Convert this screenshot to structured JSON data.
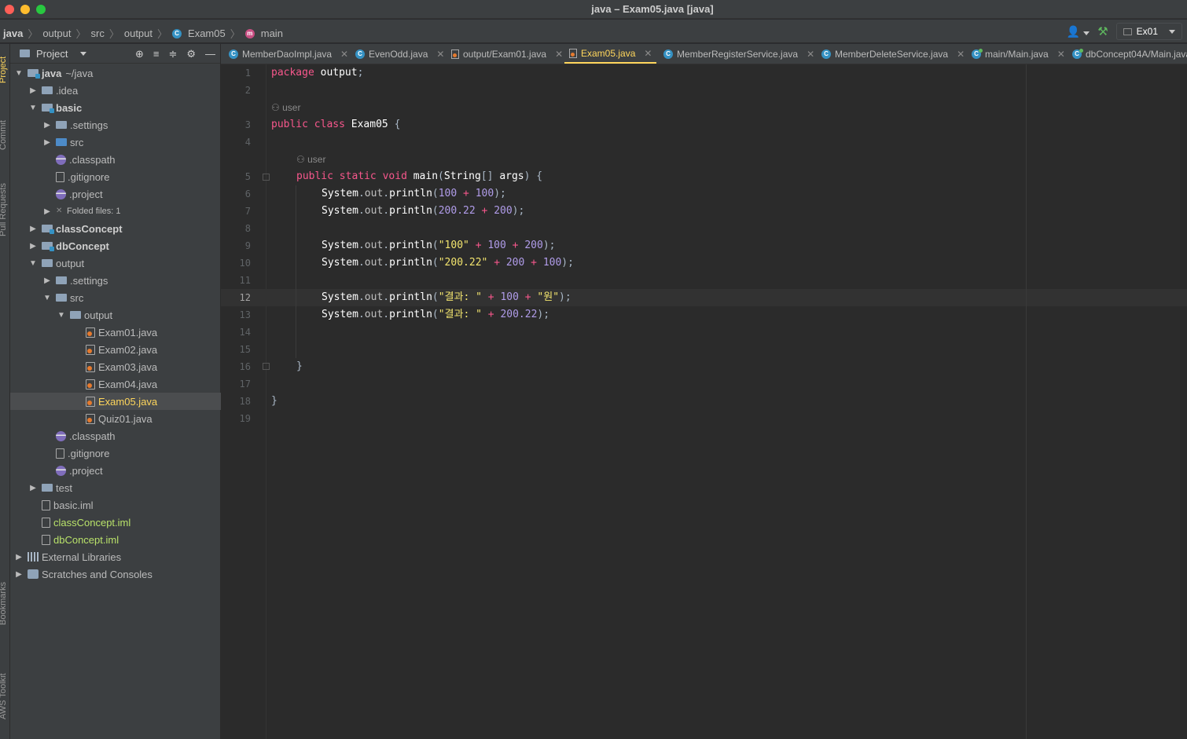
{
  "window": {
    "title": "java – Exam05.java [java]"
  },
  "breadcrumb": {
    "items": [
      "java",
      "output",
      "src",
      "output",
      "Exam05",
      "main"
    ]
  },
  "toolbar": {
    "run_config": "Ex01"
  },
  "stripe": {
    "labels": [
      "Project",
      "Commit",
      "Pull Requests",
      "Bookmarks",
      "AWS Toolkit"
    ]
  },
  "project_panel": {
    "title": "Project",
    "tree": [
      {
        "label": "java",
        "suffix": "~/java"
      },
      {
        "label": ".idea"
      },
      {
        "label": "basic"
      },
      {
        "label": ".settings"
      },
      {
        "label": "src"
      },
      {
        "label": ".classpath"
      },
      {
        "label": ".gitignore"
      },
      {
        "label": ".project"
      },
      {
        "label": "Folded files: 1"
      },
      {
        "label": "classConcept"
      },
      {
        "label": "dbConcept"
      },
      {
        "label": "output"
      },
      {
        "label": ".settings"
      },
      {
        "label": "src"
      },
      {
        "label": "output"
      },
      {
        "label": "Exam01.java"
      },
      {
        "label": "Exam02.java"
      },
      {
        "label": "Exam03.java"
      },
      {
        "label": "Exam04.java"
      },
      {
        "label": "Exam05.java"
      },
      {
        "label": "Quiz01.java"
      },
      {
        "label": ".classpath"
      },
      {
        "label": ".gitignore"
      },
      {
        "label": ".project"
      },
      {
        "label": "test"
      },
      {
        "label": "basic.iml"
      },
      {
        "label": "classConcept.iml"
      },
      {
        "label": "dbConcept.iml"
      },
      {
        "label": "External Libraries"
      },
      {
        "label": "Scratches and Consoles"
      }
    ]
  },
  "tabs": [
    {
      "label": "MemberDaoImpl.java"
    },
    {
      "label": "EvenOdd.java"
    },
    {
      "label": "output/Exam01.java"
    },
    {
      "label": "Exam05.java"
    },
    {
      "label": "MemberRegisterService.java"
    },
    {
      "label": "MemberDeleteService.java"
    },
    {
      "label": "main/Main.java"
    },
    {
      "label": "dbConcept04A/Main.java"
    }
  ],
  "editor": {
    "line_numbers": [
      "1",
      "2",
      "3",
      "4",
      "5",
      "6",
      "7",
      "8",
      "9",
      "10",
      "11",
      "12",
      "13",
      "14",
      "15",
      "16",
      "17",
      "18",
      "19"
    ],
    "current_line": "12",
    "author_hint": "user",
    "code": {
      "package_kw": "package",
      "package_name": "output",
      "public1": "public",
      "class_kw": "class",
      "class_name": "Exam05",
      "public2": "public",
      "static_kw": "static",
      "void_kw": "void",
      "method": "main",
      "string_type": "String",
      "args": "args",
      "system": "System",
      "out": "out",
      "println": "println",
      "n100": "100",
      "n200": "200",
      "n20022": "200.22",
      "s100": "\"100\"",
      "s20022": "\"200.22\"",
      "s_result": "\"결과: \"",
      "s_won": "\"원\""
    }
  }
}
